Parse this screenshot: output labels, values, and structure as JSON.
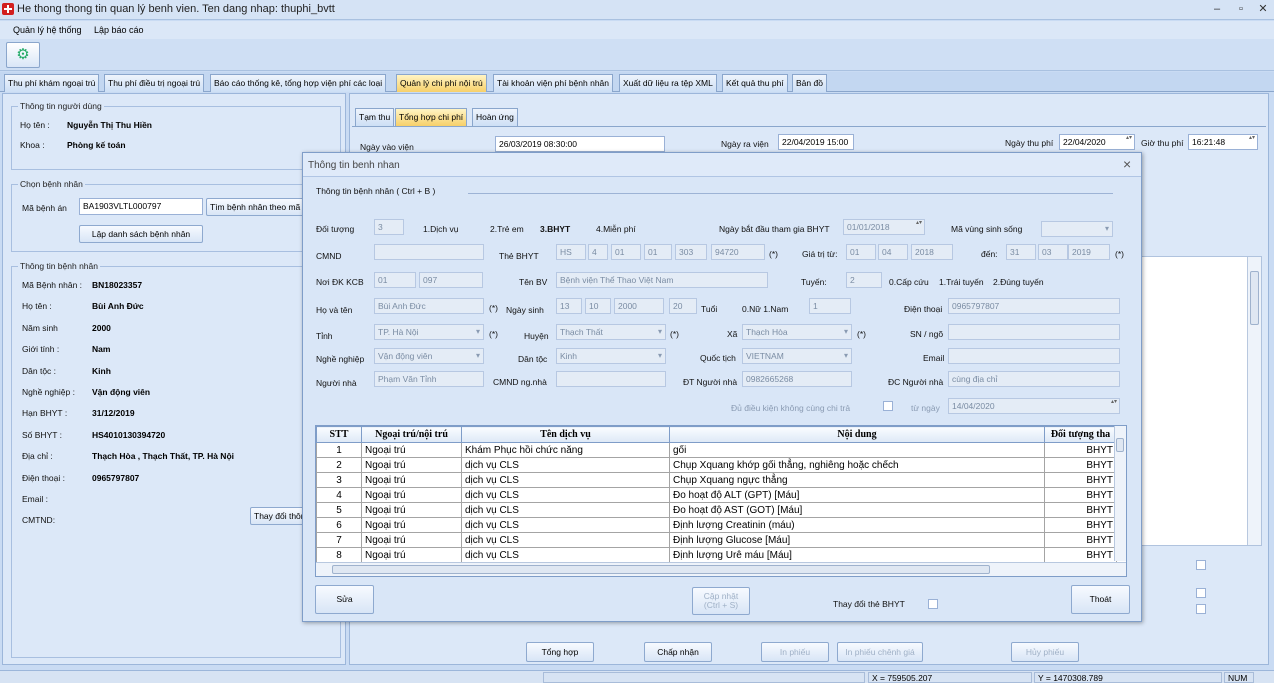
{
  "window": {
    "title": "He thong thong tin quan lý benh vien. Ten dang nhap: thuphi_bvtt",
    "minimize": "–",
    "maximize": "▫",
    "close": "✕"
  },
  "menu": [
    "Quản lý hệ thống",
    "Lập báo cáo"
  ],
  "main_tabs": [
    "Thu phí khám ngoại trú",
    "Thu phí điều trị ngoại trú",
    "Báo cáo thống kê, tổng hợp viện phí các loại",
    "Quản lý chi phí nội trú",
    "Tài khoản viện phí bệnh nhân",
    "Xuất dữ liệu ra tệp XML",
    "Kết quả thu phí",
    "Bản đồ"
  ],
  "user_info": {
    "legend": "Thông tin người dùng",
    "name_label": "Họ tên :",
    "name": "Nguyễn Thị Thu Hiền",
    "dept_label": "Khoa :",
    "dept": "Phòng kế toán"
  },
  "choose_patient": {
    "legend": "Chọn bệnh nhân",
    "record_label": "Mã bệnh án",
    "record_value": "BA1903VLTL000797",
    "search_button": "Tìm bệnh nhân theo mã",
    "list_button": "Lập danh sách bệnh nhân"
  },
  "patient_info": {
    "legend": "Thông tin bệnh nhân",
    "rows": [
      {
        "label": "Mã Bệnh nhân :",
        "value": "BN18023357"
      },
      {
        "label": "Họ tên :",
        "value": "Bùi Anh Đức"
      },
      {
        "label": "Năm sinh",
        "value": "2000"
      },
      {
        "label": "Giới tính :",
        "value": "Nam"
      },
      {
        "label": "Dân tộc :",
        "value": "Kinh"
      },
      {
        "label": "Nghề nghiệp :",
        "value": "Vận động viên"
      },
      {
        "label": "Hạn BHYT :",
        "value": "31/12/2019"
      },
      {
        "label": "Số BHYT :",
        "value": "HS4010130394720"
      },
      {
        "label": "Địa chỉ :",
        "value": "Thạch Hòa , Thạch Thất, TP. Hà Nội"
      },
      {
        "label": "Điện thoại :",
        "value": "0965797807"
      },
      {
        "label": "Email :",
        "value": ""
      },
      {
        "label": "CMTND:",
        "value": ""
      }
    ],
    "change_button": "Thay đổi thông tin"
  },
  "sub_tabs": [
    "Tạm thu",
    "Tổng hợp chi phí",
    "Hoàn ứng"
  ],
  "admission": {
    "in_label": "Ngày vào viện",
    "in_value": "26/03/2019 08:30:00",
    "out_label": "Ngày ra viện",
    "out_value": "22/04/2019 15:00",
    "pay_date_label": "Ngày thu phí",
    "pay_date": "22/04/2020",
    "pay_time_label": "Giờ thu phí",
    "pay_time": "16:21:48"
  },
  "bottom_buttons": [
    "Tổng hợp",
    "Chấp nhận",
    "In phiếu",
    "In phiếu chênh giá",
    "Hủy phiếu"
  ],
  "dialog": {
    "title": "Thông tin benh nhan",
    "close": "×",
    "section": "Thông tin bệnh nhân ( Ctrl + B )",
    "doi_tuong_label": "Đối tượng",
    "doi_tuong_value": "3",
    "doi_tuong_options": [
      "1.Dịch vụ",
      "2.Trẻ em",
      "3.BHYT",
      "4.Miễn phí"
    ],
    "start_date_label": "Ngày bắt đầu tham gia BHYT",
    "start_date": "01/01/2018",
    "region_label": "Mã vùng sinh sống",
    "cmnd_label": "CMND",
    "bhyt_label": "Thẻ BHYT",
    "bhyt_parts": [
      "HS",
      "4",
      "01",
      "01",
      "303",
      "94720"
    ],
    "req": "(*)",
    "valid_from_label": "Giá trị từ:",
    "valid_from": [
      "01",
      "04",
      "2018"
    ],
    "to_label": "đến:",
    "valid_to": [
      "31",
      "03",
      "2019"
    ],
    "kcb_label": "Nơi ĐK KCB",
    "kcb_parts": [
      "01",
      "097"
    ],
    "hospital_label": "Tên BV",
    "hospital": "Bệnh viện Thể Thao Việt Nam",
    "tier_label": "Tuyến:",
    "tier_value": "2",
    "tier_options": [
      "0.Cấp cứu",
      "1.Trái tuyến",
      "2.Đúng tuyến"
    ],
    "fullname_label": "Họ và tên",
    "fullname": "Bùi Anh Đức",
    "dob_label": "Ngày sinh",
    "dob": [
      "13",
      "10",
      "2000"
    ],
    "age": "20",
    "age_label": "Tuổi",
    "gender_label": "0.Nữ  1.Nam",
    "gender_value": "1",
    "phone_label": "Điện thoại",
    "phone": "0965797807",
    "province_label": "Tỉnh",
    "province": "TP. Hà Nội",
    "district_label": "Huyện",
    "district": "Thạch Thất",
    "commune_label": "Xã",
    "commune": "Thạch Hòa",
    "house_label": "SN / ngõ",
    "job_label": "Nghề nghiệp",
    "job": "Vận động viên",
    "ethnic_label": "Dân tộc",
    "ethnic": "Kinh",
    "nation_label": "Quốc tịch",
    "nation": "VIETNAM",
    "email_label": "Email",
    "relative_label": "Người nhà",
    "relative": "Phạm Văn Tỉnh",
    "relative_id_label": "CMND ng.nhà",
    "relative_phone_label": "ĐT Người nhà",
    "relative_phone": "0982665268",
    "relative_addr_label": "ĐC Người nhà",
    "relative_addr": "cùng địa chỉ",
    "no_copay_label": "Đủ điều kiện không cùng chi trả",
    "from_date_label": "từ ngày",
    "from_date": "14/04/2020",
    "columns": [
      "STT",
      "Ngoại trú/nội trú",
      "Tên dịch vụ",
      "Nội dung",
      "Đối tượng tha"
    ],
    "rows": [
      [
        "1",
        "Ngoại trú",
        "Khám Phục hồi chức năng",
        "gối",
        "BHYT"
      ],
      [
        "2",
        "Ngoại trú",
        "dịch vụ CLS",
        "Chụp Xquang khớp gối thẳng, nghiêng hoặc chếch",
        "BHYT"
      ],
      [
        "3",
        "Ngoại trú",
        "dịch vụ CLS",
        "Chụp Xquang ngực thẳng",
        "BHYT"
      ],
      [
        "4",
        "Ngoại trú",
        "dịch vụ CLS",
        "Đo hoạt độ ALT (GPT) [Máu]",
        "BHYT"
      ],
      [
        "5",
        "Ngoại trú",
        "dịch vụ CLS",
        "Đo hoạt độ AST (GOT) [Máu]",
        "BHYT"
      ],
      [
        "6",
        "Ngoại trú",
        "dịch vụ CLS",
        "Định lượng Creatinin (máu)",
        "BHYT"
      ],
      [
        "7",
        "Ngoại trú",
        "dịch vụ CLS",
        "Định lượng Glucose [Máu]",
        "BHYT"
      ],
      [
        "8",
        "Ngoại trú",
        "dịch vụ CLS",
        "Định lượng Urê máu [Máu]",
        "BHYT"
      ]
    ],
    "edit_button": "Sửa",
    "update_button_line1": "Cập nhật",
    "update_button_line2": "(Ctrl + S)",
    "change_bhyt_label": "Thay đổi thẻ BHYT",
    "exit_button": "Thoát"
  },
  "status": {
    "x": "X = 759505.207",
    "y": "Y = 1470308.789",
    "num": "NUM"
  }
}
